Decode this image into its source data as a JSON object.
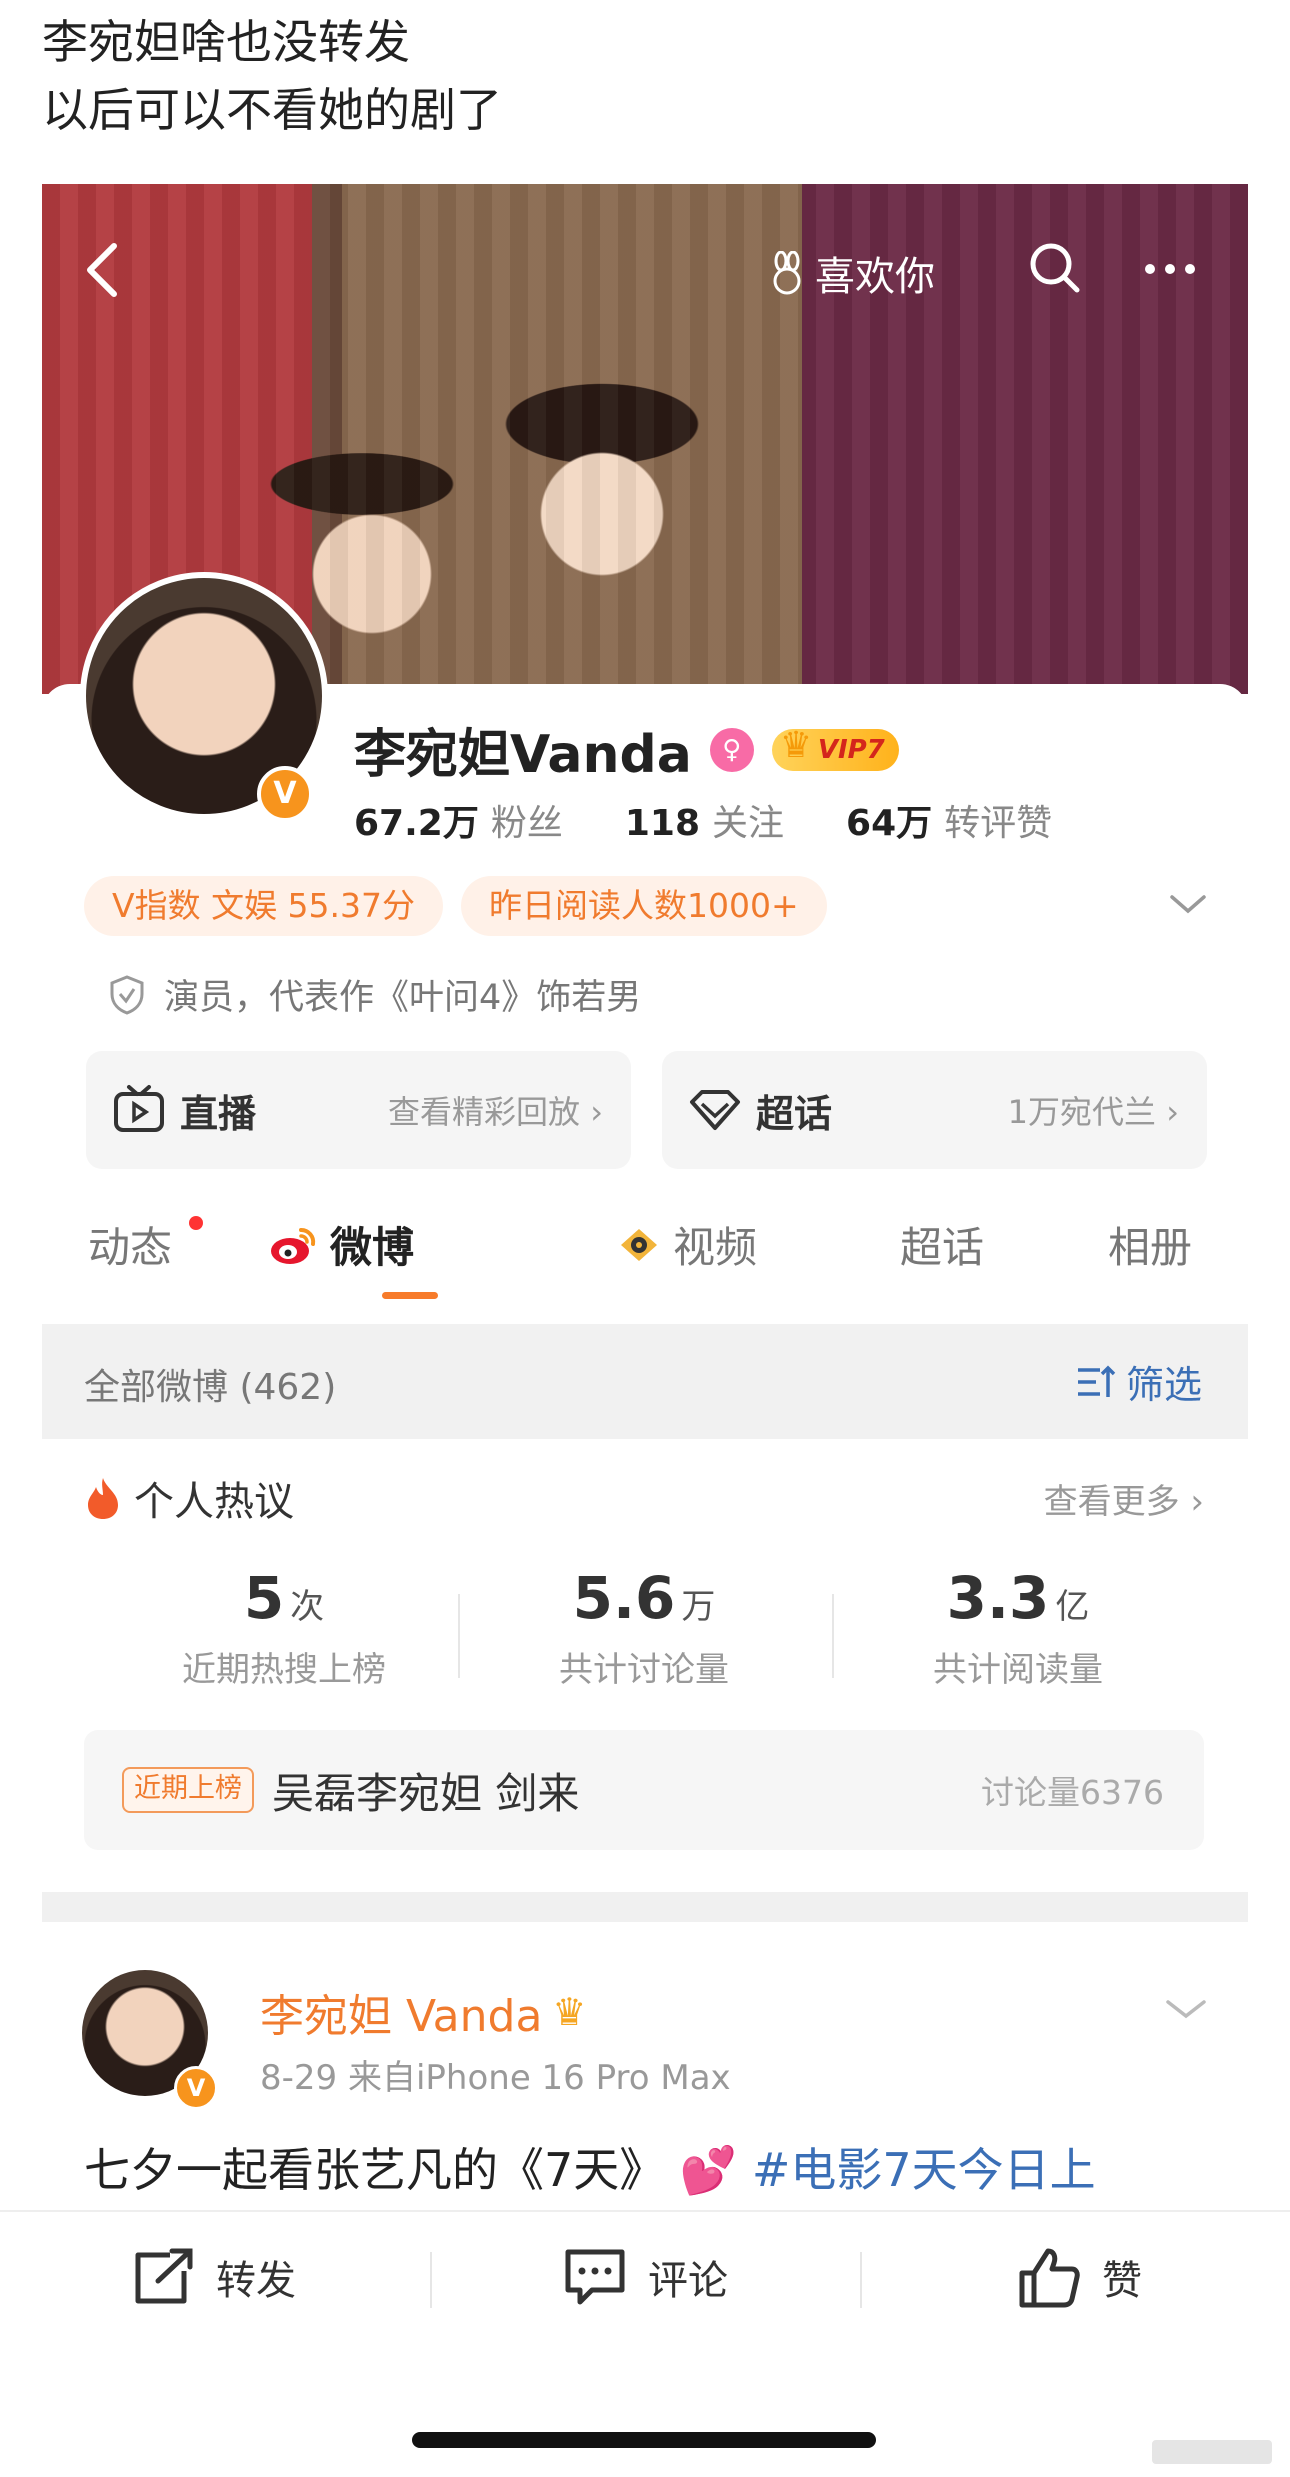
{
  "caption": {
    "line1": "李宛妲啥也没转发",
    "line2": "以后可以不看她的剧了"
  },
  "topbar": {
    "like_label": "喜欢你"
  },
  "profile": {
    "name": "李宛妲Vanda",
    "vip_badge": "VIP7",
    "verified_mark": "V",
    "followers_count": "67.2万",
    "followers_label": "粉丝",
    "following_count": "118",
    "following_label": "关注",
    "interactions_count": "64万",
    "interactions_label": "转评赞",
    "tags": [
      "V指数 文娱 55.37分",
      "昨日阅读人数1000+"
    ],
    "description": "演员，代表作《叶问4》饰若男"
  },
  "entries": {
    "live_title": "直播",
    "live_sub": "查看精彩回放 ›",
    "supertopic_title": "超话",
    "supertopic_sub": "1万宛代兰 ›"
  },
  "tabs": [
    "动态",
    "微博",
    "视频",
    "超话",
    "相册"
  ],
  "filter": {
    "all_posts": "全部微博 (462)",
    "filter_label": "筛选"
  },
  "hot_discussion": {
    "title": "个人热议",
    "more": "查看更多 ›",
    "metrics": [
      {
        "value": "5",
        "unit": "次",
        "label": "近期热搜上榜"
      },
      {
        "value": "5.6",
        "unit": "万",
        "label": "共计讨论量"
      },
      {
        "value": "3.3",
        "unit": "亿",
        "label": "共计阅读量"
      }
    ],
    "trend_badge": "近期上榜",
    "trend_topic": "吴磊李宛妲 剑来",
    "trend_count": "讨论量6376"
  },
  "post": {
    "author": "李宛妲 Vanda",
    "meta": "8-29  来自iPhone 16 Pro Max",
    "text_prefix": "七夕一起看张艺凡的《7天》",
    "text_emoji": "💕",
    "text_topic": "#电影7天今日上"
  },
  "actions": {
    "repost": "转发",
    "comment": "评论",
    "like": "赞"
  },
  "colors": {
    "accent_orange": "#f07b2e",
    "link_blue": "#3b6fb6"
  }
}
